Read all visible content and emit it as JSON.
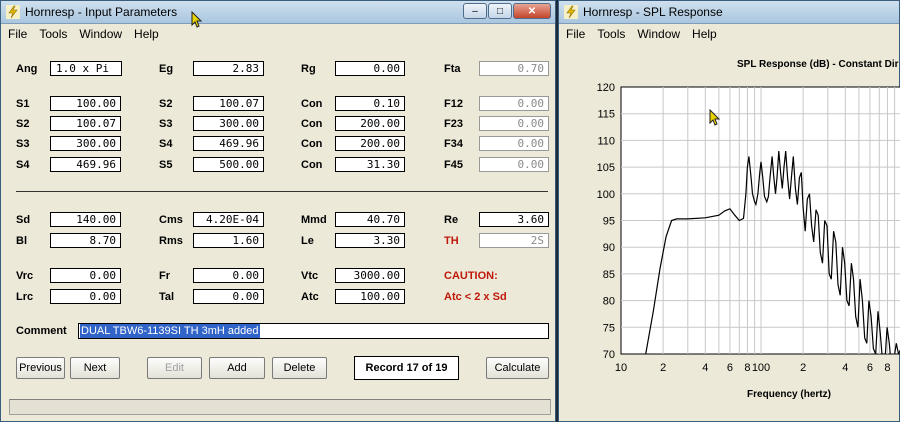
{
  "input_window": {
    "title": "Hornresp - Input Parameters",
    "menu": [
      "File",
      "Tools",
      "Window",
      "Help"
    ],
    "params": {
      "Ang": "1.0 x Pi",
      "Eg": "2.83",
      "Rg": "0.00",
      "Fta": "0.70",
      "S1": "100.00",
      "S2": "100.07",
      "Con1": "0.10",
      "F12": "0.00",
      "S2b": "100.07",
      "S3": "300.00",
      "Con2": "200.00",
      "F23": "0.00",
      "S3b": "300.00",
      "S4": "469.96",
      "Con3": "200.00",
      "F34": "0.00",
      "S4b": "469.96",
      "S5": "500.00",
      "Con4": "31.30",
      "F45": "0.00",
      "Sd": "140.00",
      "Cms": "4.20E-04",
      "Mmd": "40.70",
      "Re": "3.60",
      "Bl": "8.70",
      "Rms": "1.60",
      "Le": "3.30",
      "TH": "2S",
      "Vrc": "0.00",
      "Fr": "0.00",
      "Vtc": "3000.00",
      "Lrc": "0.00",
      "Tal": "0.00",
      "Atc": "100.00"
    },
    "labels": {
      "Ang": "Ang",
      "Eg": "Eg",
      "Rg": "Rg",
      "Fta": "Fta",
      "S1": "S1",
      "S2": "S2",
      "Con": "Con",
      "F12": "F12",
      "S3": "S3",
      "F23": "F23",
      "S4": "S4",
      "F34": "F34",
      "S5": "S5",
      "F45": "F45",
      "Sd": "Sd",
      "Cms": "Cms",
      "Mmd": "Mmd",
      "Re": "Re",
      "Bl": "Bl",
      "Rms": "Rms",
      "Le": "Le",
      "TH": "TH",
      "Vrc": "Vrc",
      "Fr": "Fr",
      "Vtc": "Vtc",
      "Lrc": "Lrc",
      "Tal": "Tal",
      "Atc": "Atc",
      "caution": "CAUTION:",
      "caution_msg": "Atc < 2 x Sd",
      "comment": "Comment"
    },
    "comment_value": "DUAL TBW6-1139SI TH 3mH added",
    "buttons": {
      "previous": "Previous",
      "next": "Next",
      "edit": "Edit",
      "add": "Add",
      "delete": "Delete",
      "calculate": "Calculate"
    },
    "record": "Record 17 of 19"
  },
  "spl_window": {
    "title": "Hornresp - SPL Response",
    "menu": [
      "File",
      "Tools",
      "Window",
      "Help"
    ]
  },
  "colors": {
    "label_red": "#c0180a",
    "selection": "#3164c8",
    "trace": "#000000"
  },
  "chart_data": {
    "type": "line",
    "title": "SPL Response (dB) - Constant Dir",
    "xlabel": "Frequency (hertz)",
    "ylabel": "",
    "x_scale": "log",
    "xlim": [
      10,
      1000
    ],
    "ylim": [
      70,
      120
    ],
    "yticks": [
      70,
      75,
      80,
      85,
      90,
      95,
      100,
      105,
      110,
      115,
      120
    ],
    "xtick_labels": [
      {
        "value": 10,
        "label": "10"
      },
      {
        "value": 20,
        "label": "2"
      },
      {
        "value": 40,
        "label": "4"
      },
      {
        "value": 60,
        "label": "6"
      },
      {
        "value": 80,
        "label": "8"
      },
      {
        "value": 100,
        "label": "100"
      },
      {
        "value": 200,
        "label": "2"
      },
      {
        "value": 400,
        "label": "4"
      },
      {
        "value": 600,
        "label": "6"
      },
      {
        "value": 800,
        "label": "8"
      }
    ],
    "grid": true,
    "series": [
      {
        "x": [
          15,
          17,
          19,
          21,
          23,
          25,
          30,
          40,
          50,
          55,
          60,
          65,
          70,
          75,
          78,
          80,
          82,
          85,
          87,
          90,
          92,
          95,
          98,
          100,
          103,
          106,
          110,
          113,
          116,
          120,
          123,
          127,
          130,
          134,
          138,
          142,
          146,
          150,
          155,
          160,
          165,
          170,
          176,
          182,
          188,
          194,
          200,
          207,
          214,
          222,
          230,
          238,
          247,
          256,
          265,
          275,
          285,
          296,
          307,
          318,
          330,
          342,
          355,
          368,
          382,
          396,
          411,
          426,
          442,
          458,
          475,
          492,
          510,
          530,
          550,
          570,
          590,
          612,
          635,
          660,
          685,
          710,
          737,
          765,
          795,
          825,
          857,
          890,
          925,
          960,
          1000
        ],
        "y": [
          70,
          78,
          86,
          92,
          95,
          95.3,
          95.3,
          95.5,
          96,
          96.8,
          97.2,
          96,
          95,
          95.4,
          100,
          105,
          107,
          103,
          100,
          98.5,
          98,
          100,
          104,
          106,
          103,
          99.5,
          98.5,
          99.5,
          103,
          107,
          103.5,
          100,
          103,
          108,
          104,
          101,
          105,
          108,
          103,
          99,
          103,
          107,
          101,
          98,
          103,
          104,
          97.5,
          93,
          99,
          100,
          94,
          91,
          97,
          96,
          89,
          87,
          95,
          94,
          85,
          84,
          93,
          91,
          83,
          81,
          90,
          87,
          80,
          79,
          87,
          84,
          77,
          75,
          84,
          80,
          73,
          72,
          80,
          77,
          71,
          70,
          78,
          74,
          69,
          68,
          75,
          72,
          67,
          69,
          72,
          70,
          71
        ]
      }
    ]
  }
}
